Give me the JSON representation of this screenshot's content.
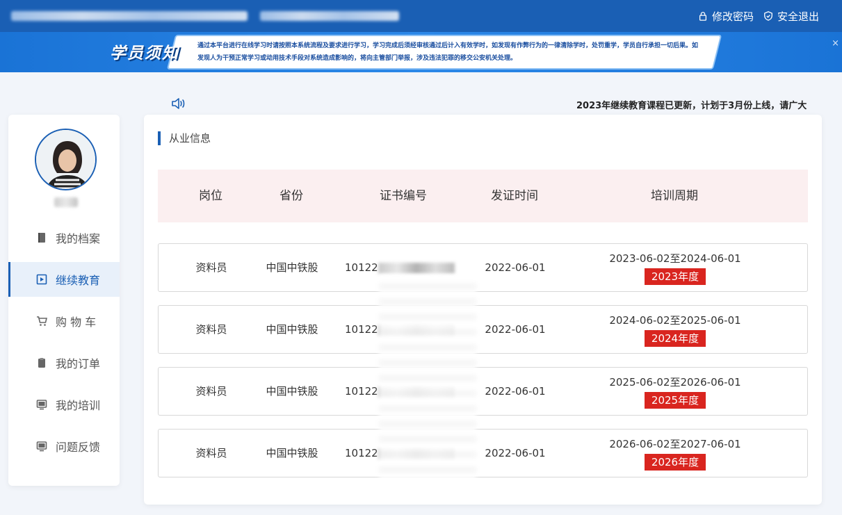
{
  "topbar": {
    "actions": [
      {
        "icon": "lock-icon",
        "label": "修改密码"
      },
      {
        "icon": "shield-icon",
        "label": "安全退出"
      }
    ]
  },
  "banner": {
    "tag": "学员须知",
    "text": "通过本平台进行在线学习时请按照本系统流程及要求进行学习，学习完成后须经审核通过后计入有效学时，如发现有作弊行为的一律清除学时，处罚重学，学员自行承担一切后果。如发现人为干预正常学习或动用技术手段对系统造成影响的，将向主管部门举报，涉及违法犯罪的移交公安机关处理。",
    "close": "×"
  },
  "notice": {
    "icon": "speaker-icon",
    "text": "2023年继续教育课程已更新，计划于3月份上线，请广大"
  },
  "sidebar": {
    "items": [
      {
        "label": "我的档案",
        "icon": "book-icon",
        "active": false
      },
      {
        "label": "继续教育",
        "icon": "play-icon",
        "active": true
      },
      {
        "label": "购 物 车",
        "icon": "cart-icon",
        "active": false
      },
      {
        "label": "我的订单",
        "icon": "clipboard-icon",
        "active": false
      },
      {
        "label": "我的培训",
        "icon": "monitor-icon",
        "active": false
      },
      {
        "label": "问题反馈",
        "icon": "monitor-icon",
        "active": false
      }
    ]
  },
  "main": {
    "section_title": "从业信息",
    "columns": [
      "岗位",
      "省份",
      "证书编号",
      "发证时间",
      "培训周期"
    ],
    "rows": [
      {
        "position": "资料员",
        "province": "中国中铁股",
        "cert_prefix": "10122",
        "issue_date": "2022-06-01",
        "period": "2023-06-02至2024-06-01",
        "year": "2023年度"
      },
      {
        "position": "资料员",
        "province": "中国中铁股",
        "cert_prefix": "10122",
        "issue_date": "2022-06-01",
        "period": "2024-06-02至2025-06-01",
        "year": "2024年度"
      },
      {
        "position": "资料员",
        "province": "中国中铁股",
        "cert_prefix": "10122",
        "issue_date": "2022-06-01",
        "period": "2025-06-02至2026-06-01",
        "year": "2025年度"
      },
      {
        "position": "资料员",
        "province": "中国中铁股",
        "cert_prefix": "10122",
        "issue_date": "2022-06-01",
        "period": "2026-06-02至2027-06-01",
        "year": "2026年度"
      }
    ]
  },
  "colors": {
    "primary": "#1a5fb4",
    "badge": "#d9251f",
    "header_bg": "#fbeff0"
  }
}
